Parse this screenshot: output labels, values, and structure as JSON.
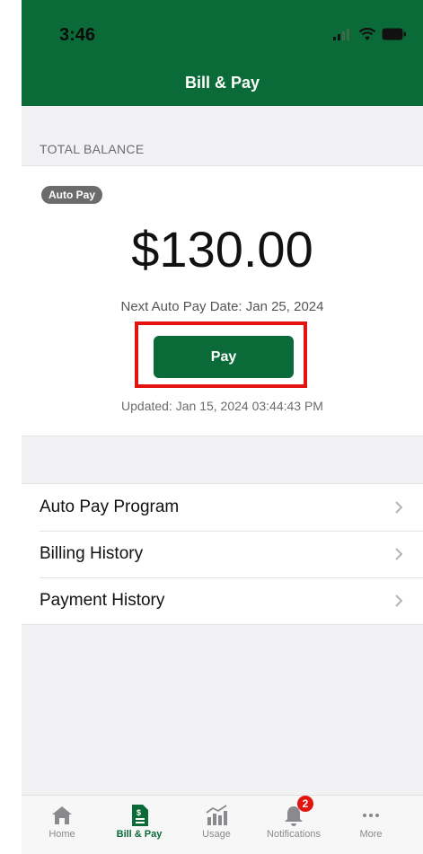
{
  "status_bar": {
    "time": "3:46"
  },
  "header": {
    "title": "Bill & Pay"
  },
  "balance": {
    "section_label": "TOTAL BALANCE",
    "autopay_badge": "Auto Pay",
    "amount": "$130.00",
    "next_date": "Next Auto Pay Date: Jan 25, 2024",
    "pay_button": "Pay",
    "updated": "Updated: Jan 15, 2024 03:44:43 PM"
  },
  "menu": [
    {
      "label": "Auto Pay Program"
    },
    {
      "label": "Billing History"
    },
    {
      "label": "Payment History"
    }
  ],
  "tabbar": {
    "tabs": [
      {
        "label": "Home",
        "icon": "home-icon"
      },
      {
        "label": "Bill & Pay",
        "icon": "bill-icon"
      },
      {
        "label": "Usage",
        "icon": "usage-icon"
      },
      {
        "label": "Notifications",
        "icon": "bell-icon",
        "badge": "2"
      },
      {
        "label": "More",
        "icon": "more-icon"
      }
    ]
  },
  "colors": {
    "brand_green": "#0b6b38",
    "highlight_red": "#e3140f"
  }
}
